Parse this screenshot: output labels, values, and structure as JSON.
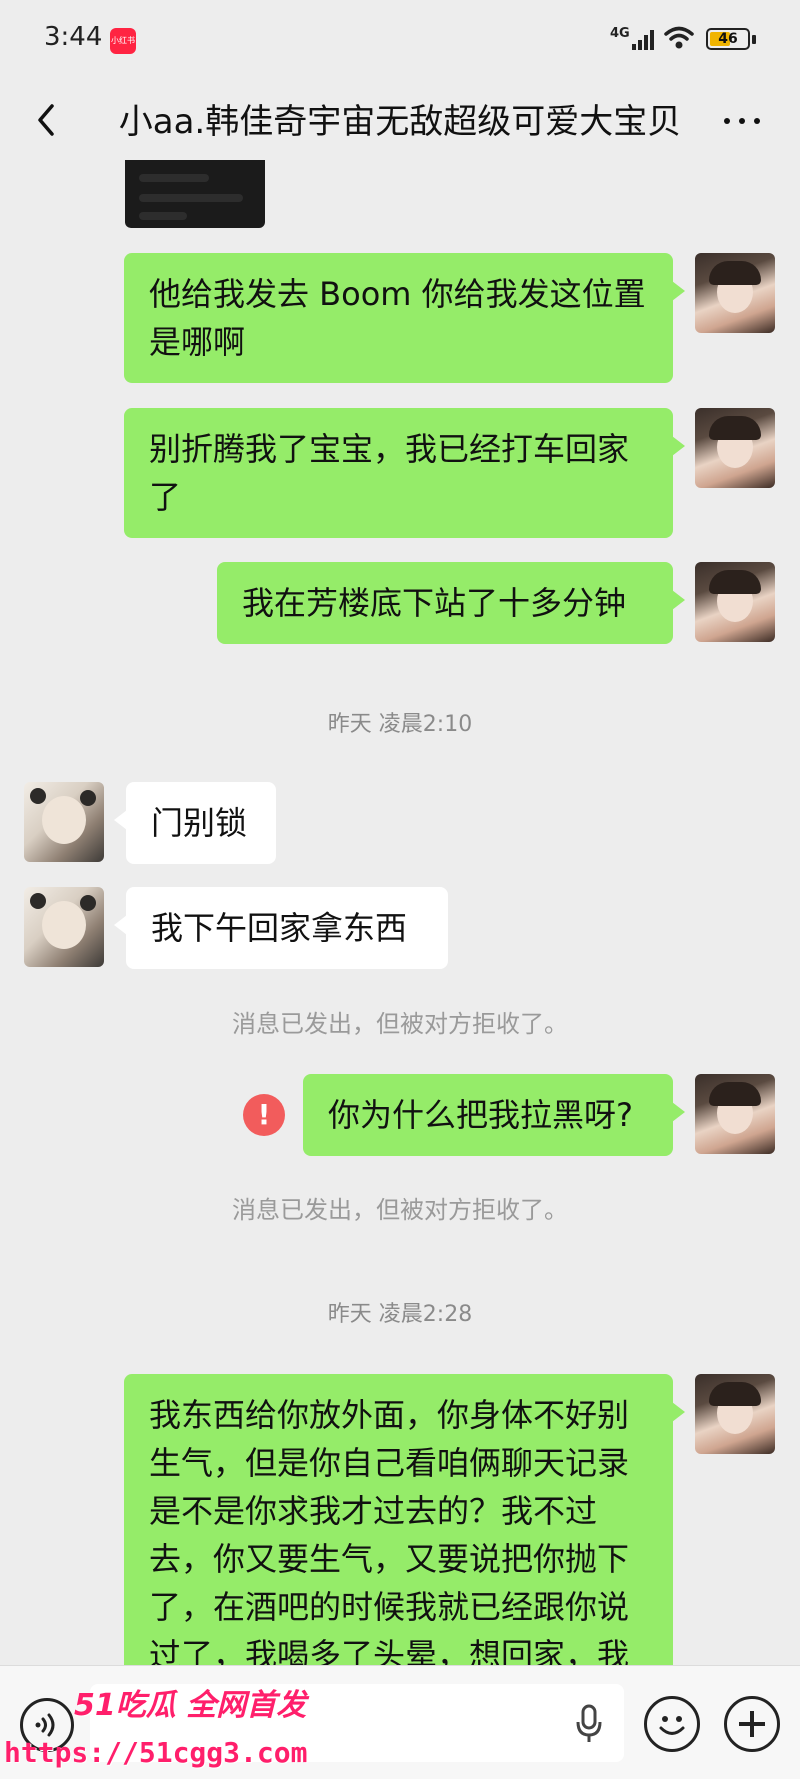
{
  "status_bar": {
    "time": "3:44",
    "app_badge": "小红书",
    "network": "4G",
    "battery": "46",
    "battery_color": "#f0b400"
  },
  "header": {
    "title": "小aa.韩佳奇宇宙无敌超级可爱大宝贝",
    "back_icon": "chevron-left-icon",
    "more_icon": "more-dots-icon"
  },
  "messages": [
    {
      "side": "me",
      "text": "他给我发去 Boom  你给我发这位置是哪啊"
    },
    {
      "side": "me",
      "text": "别折腾我了宝宝，我已经打车回家了"
    },
    {
      "side": "me",
      "text": "我在芳楼底下站了十多分钟"
    },
    {
      "type": "time",
      "text": "昨天 凌晨2:10"
    },
    {
      "side": "them",
      "text": "门别锁"
    },
    {
      "side": "them",
      "text": "我下午回家拿东西"
    },
    {
      "type": "system",
      "text": "消息已发出，但被对方拒收了。"
    },
    {
      "side": "me",
      "text": "你为什么把我拉黑呀?",
      "failed": true
    },
    {
      "type": "system",
      "text": "消息已发出，但被对方拒收了。"
    },
    {
      "type": "time",
      "text": "昨天 凌晨2:28"
    },
    {
      "side": "me",
      "text": "我东西给你放外面，你身体不好别生气，但是你自己看咱俩聊天记录是不是你求我才过去的？我不过去，你又要生气，又要说把你抛下了，在酒吧的时候我就已经跟你说过了，我喝多了头晕，想回家，我"
    }
  ],
  "error_icon_text": "!",
  "bottom_bar": {
    "voice_icon": "voice-icon",
    "mic_icon": "mic-icon",
    "emoji_icon": "emoji-icon",
    "plus_icon": "plus-icon"
  },
  "watermark": {
    "brand": "51吃瓜 全网首发",
    "url": "https://51cgg3.com"
  },
  "colors": {
    "bubble_me": "#95ec69",
    "bubble_them": "#ffffff",
    "background": "#ededed",
    "error": "#f25c5c",
    "watermark": "#ff1f6b"
  }
}
